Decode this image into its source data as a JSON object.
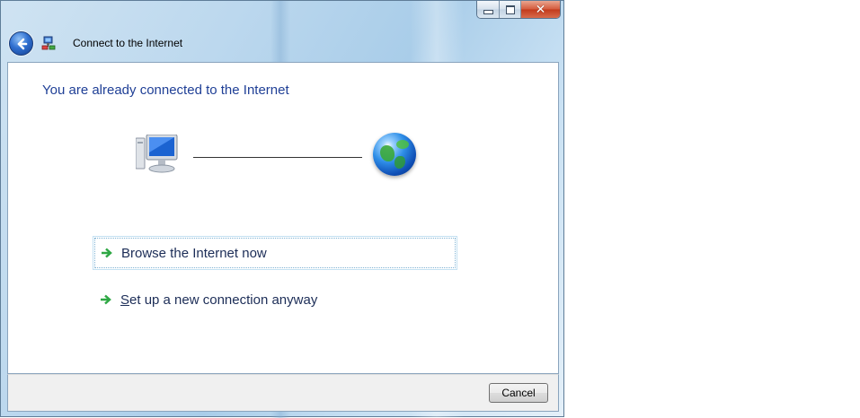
{
  "window": {
    "title": "Connect to the Internet",
    "caption": {
      "close_glyph": "✕"
    }
  },
  "content": {
    "heading": "You are already connected to the Internet",
    "options": [
      {
        "label": "Browse the Internet now",
        "focused": true
      },
      {
        "label_access_key": "S",
        "label_rest": "et up a new connection anyway"
      }
    ]
  },
  "footer": {
    "cancel_label": "Cancel"
  },
  "icons": {
    "back": "back-arrow-icon",
    "title": "network-icon",
    "computer": "computer-icon",
    "globe": "globe-icon",
    "command_arrow": "green-arrow-icon"
  },
  "colors": {
    "heading": "#1f3f96",
    "link_text": "#1c2d57",
    "arrow": "#2fa845",
    "close": "#c2391b"
  }
}
